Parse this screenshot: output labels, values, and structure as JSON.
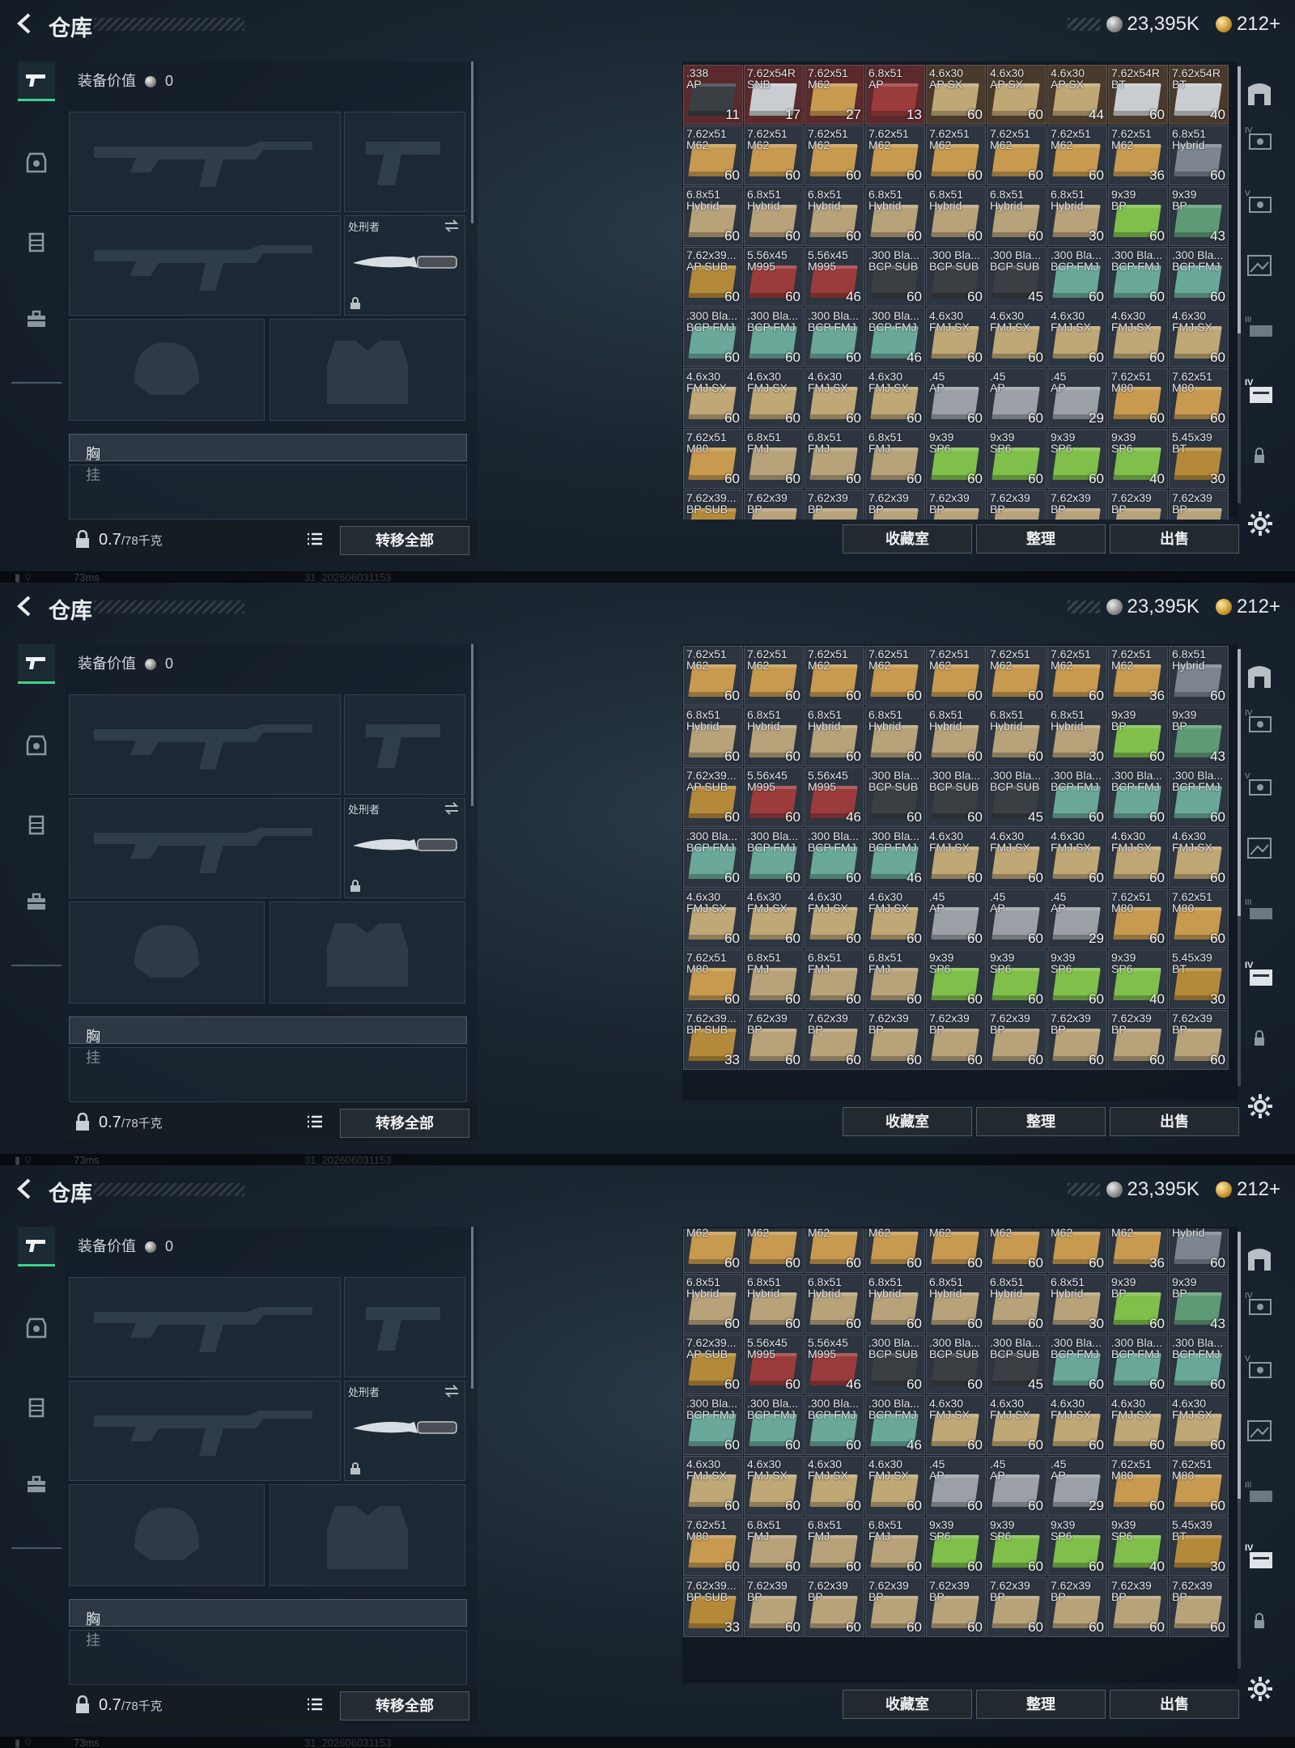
{
  "header": {
    "title": "仓库",
    "silver": "23,395K",
    "gold": "212+"
  },
  "equip": {
    "value_label": "装备价值",
    "value": "0",
    "knife_name": "处刑者",
    "vest_label": "胸挂",
    "help": "?",
    "weight_value": "0.7",
    "weight_total": "/78千克",
    "transfer_label": "转移全部"
  },
  "actions": {
    "collection": "收藏室",
    "organize": "整理",
    "sell": "出售"
  },
  "status": {
    "ping": "73ms",
    "build": "31_202606031153"
  },
  "colors": {
    "accent_green": "#3fd18a"
  },
  "item_colors": {
    "red": "#9b3b3b",
    "silver": "#c9ccd0",
    "kraft": "#c79a50",
    "tan": "#bfa776",
    "lime": "#7fbf4a",
    "green": "#5f9a76",
    "teal": "#6aa89a",
    "gunmetal": "#9aa0a6",
    "olive": "#b7a27a",
    "brass": "#b48a3a",
    "grey": "#7d8590",
    "dark": "#3a3f44"
  },
  "stash_rows": [
    [
      {
        "n": ".338\nAP",
        "c": "11",
        "k": "dark",
        "bg": "#5a2a2c"
      },
      {
        "n": "7.62x54R\nSNB",
        "c": "17",
        "k": "silver",
        "bg": "#5a2a2c"
      },
      {
        "n": "7.62x51\nM62",
        "c": "27",
        "k": "kraft",
        "bg": "#5a2a2c"
      },
      {
        "n": "6.8x51\nAP",
        "c": "13",
        "k": "red",
        "bg": "#5a2a2c"
      },
      {
        "n": "4.6x30\nAP SX",
        "c": "60",
        "k": "tan",
        "bg": "#4a3a2c"
      },
      {
        "n": "4.6x30\nAP SX",
        "c": "60",
        "k": "tan",
        "bg": "#4a3a2c"
      },
      {
        "n": "4.6x30\nAP SX",
        "c": "44",
        "k": "tan",
        "bg": "#4a3a2c"
      },
      {
        "n": "7.62x54R\nBT",
        "c": "60",
        "k": "silver",
        "bg": "#4a3a2c"
      },
      {
        "n": "7.62x54R\nBT",
        "c": "40",
        "k": "silver",
        "bg": "#4a3a2c"
      }
    ],
    [
      {
        "n": "7.62x51\nM62",
        "c": "60",
        "k": "kraft"
      },
      {
        "n": "7.62x51\nM62",
        "c": "60",
        "k": "kraft"
      },
      {
        "n": "7.62x51\nM62",
        "c": "60",
        "k": "kraft"
      },
      {
        "n": "7.62x51\nM62",
        "c": "60",
        "k": "kraft"
      },
      {
        "n": "7.62x51\nM62",
        "c": "60",
        "k": "kraft"
      },
      {
        "n": "7.62x51\nM62",
        "c": "60",
        "k": "kraft"
      },
      {
        "n": "7.62x51\nM62",
        "c": "60",
        "k": "kraft"
      },
      {
        "n": "7.62x51\nM62",
        "c": "36",
        "k": "kraft"
      },
      {
        "n": "6.8x51\nHybrid",
        "c": "60",
        "k": "grey"
      }
    ],
    [
      {
        "n": "6.8x51\nHybrid",
        "c": "60",
        "k": "olive"
      },
      {
        "n": "6.8x51\nHybrid",
        "c": "60",
        "k": "olive"
      },
      {
        "n": "6.8x51\nHybrid",
        "c": "60",
        "k": "olive"
      },
      {
        "n": "6.8x51\nHybrid",
        "c": "60",
        "k": "olive"
      },
      {
        "n": "6.8x51\nHybrid",
        "c": "60",
        "k": "olive"
      },
      {
        "n": "6.8x51\nHybrid",
        "c": "60",
        "k": "olive"
      },
      {
        "n": "6.8x51\nHybrid",
        "c": "30",
        "k": "olive"
      },
      {
        "n": "9x39\nBP",
        "c": "60",
        "k": "lime"
      },
      {
        "n": "9x39\nBP",
        "c": "43",
        "k": "green"
      }
    ],
    [
      {
        "n": "7.62x39...\nAP SUB",
        "c": "60",
        "k": "brass"
      },
      {
        "n": "5.56x45\nM995",
        "c": "60",
        "k": "red"
      },
      {
        "n": "5.56x45\nM995",
        "c": "46",
        "k": "red"
      },
      {
        "n": ".300 Bla...\nBCP SUB",
        "c": "60",
        "k": "dark"
      },
      {
        "n": ".300 Bla...\nBCP SUB",
        "c": "60",
        "k": "dark"
      },
      {
        "n": ".300 Bla...\nBCP SUB",
        "c": "45",
        "k": "dark"
      },
      {
        "n": ".300 Bla...\nBCP FMJ",
        "c": "60",
        "k": "teal"
      },
      {
        "n": ".300 Bla...\nBCP FMJ",
        "c": "60",
        "k": "teal"
      },
      {
        "n": ".300 Bla...\nBCP FMJ",
        "c": "60",
        "k": "teal"
      }
    ],
    [
      {
        "n": ".300 Bla...\nBCP FMJ",
        "c": "60",
        "k": "teal"
      },
      {
        "n": ".300 Bla...\nBCP FMJ",
        "c": "60",
        "k": "teal"
      },
      {
        "n": ".300 Bla...\nBCP FMJ",
        "c": "60",
        "k": "teal"
      },
      {
        "n": ".300 Bla...\nBCP FMJ",
        "c": "46",
        "k": "teal"
      },
      {
        "n": "4.6x30\nFMJ SX",
        "c": "60",
        "k": "tan"
      },
      {
        "n": "4.6x30\nFMJ SX",
        "c": "60",
        "k": "tan"
      },
      {
        "n": "4.6x30\nFMJ SX",
        "c": "60",
        "k": "tan"
      },
      {
        "n": "4.6x30\nFMJ SX",
        "c": "60",
        "k": "tan"
      },
      {
        "n": "4.6x30\nFMJ SX",
        "c": "60",
        "k": "tan"
      }
    ],
    [
      {
        "n": "4.6x30\nFMJ SX",
        "c": "60",
        "k": "tan"
      },
      {
        "n": "4.6x30\nFMJ SX",
        "c": "60",
        "k": "tan"
      },
      {
        "n": "4.6x30\nFMJ SX",
        "c": "60",
        "k": "tan"
      },
      {
        "n": "4.6x30\nFMJ SX",
        "c": "60",
        "k": "tan"
      },
      {
        "n": ".45\nAP",
        "c": "60",
        "k": "gunmetal"
      },
      {
        "n": ".45\nAP",
        "c": "60",
        "k": "gunmetal"
      },
      {
        "n": ".45\nAP",
        "c": "29",
        "k": "gunmetal"
      },
      {
        "n": "7.62x51\nM80",
        "c": "60",
        "k": "kraft"
      },
      {
        "n": "7.62x51\nM80",
        "c": "60",
        "k": "kraft"
      }
    ],
    [
      {
        "n": "7.62x51\nM80",
        "c": "60",
        "k": "kraft"
      },
      {
        "n": "6.8x51\nFMJ",
        "c": "60",
        "k": "olive"
      },
      {
        "n": "6.8x51\nFMJ",
        "c": "60",
        "k": "olive"
      },
      {
        "n": "6.8x51\nFMJ",
        "c": "60",
        "k": "olive"
      },
      {
        "n": "9x39\nSP6",
        "c": "60",
        "k": "lime"
      },
      {
        "n": "9x39\nSP6",
        "c": "60",
        "k": "lime"
      },
      {
        "n": "9x39\nSP6",
        "c": "60",
        "k": "lime"
      },
      {
        "n": "9x39\nSP6",
        "c": "40",
        "k": "lime"
      },
      {
        "n": "5.45x39\nBT",
        "c": "30",
        "k": "brass"
      }
    ],
    [
      {
        "n": "7.62x39...\nBP SUB",
        "c": "33",
        "k": "brass"
      },
      {
        "n": "7.62x39\nBP",
        "c": "60",
        "k": "olive"
      },
      {
        "n": "7.62x39\nBP",
        "c": "60",
        "k": "olive"
      },
      {
        "n": "7.62x39\nBP",
        "c": "60",
        "k": "olive"
      },
      {
        "n": "7.62x39\nBP",
        "c": "60",
        "k": "olive"
      },
      {
        "n": "7.62x39\nBP",
        "c": "60",
        "k": "olive"
      },
      {
        "n": "7.62x39\nBP",
        "c": "60",
        "k": "olive"
      },
      {
        "n": "7.62x39\nBP",
        "c": "60",
        "k": "olive"
      },
      {
        "n": "7.62x39\nBP",
        "c": "60",
        "k": "olive"
      }
    ]
  ],
  "screens": [
    {
      "scroll": "top",
      "thumb": "top"
    },
    {
      "scroll": "middle",
      "thumb": "middle"
    },
    {
      "scroll": "bottom",
      "thumb": "bottom"
    }
  ]
}
